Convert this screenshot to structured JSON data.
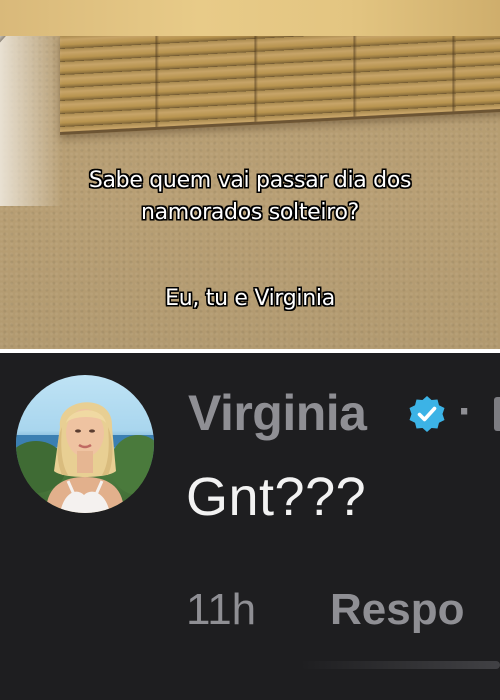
{
  "video": {
    "caption_line1": "Sabe quem vai passar dia dos",
    "caption_line2": "namorados solteiro?",
    "caption_line3": "Eu, tu e Virginia"
  },
  "comment": {
    "username": "Virginia",
    "verified": true,
    "separator": "·",
    "text": "Gnt???",
    "time": "11h",
    "reply_label": "Respo"
  },
  "colors": {
    "comment_background": "#1e1e20",
    "verified_badge": "#3cb3e6",
    "muted_text": "#8f8f94",
    "comment_text": "#f2f2f2"
  },
  "icons": {
    "verified": "verified-check-icon"
  }
}
